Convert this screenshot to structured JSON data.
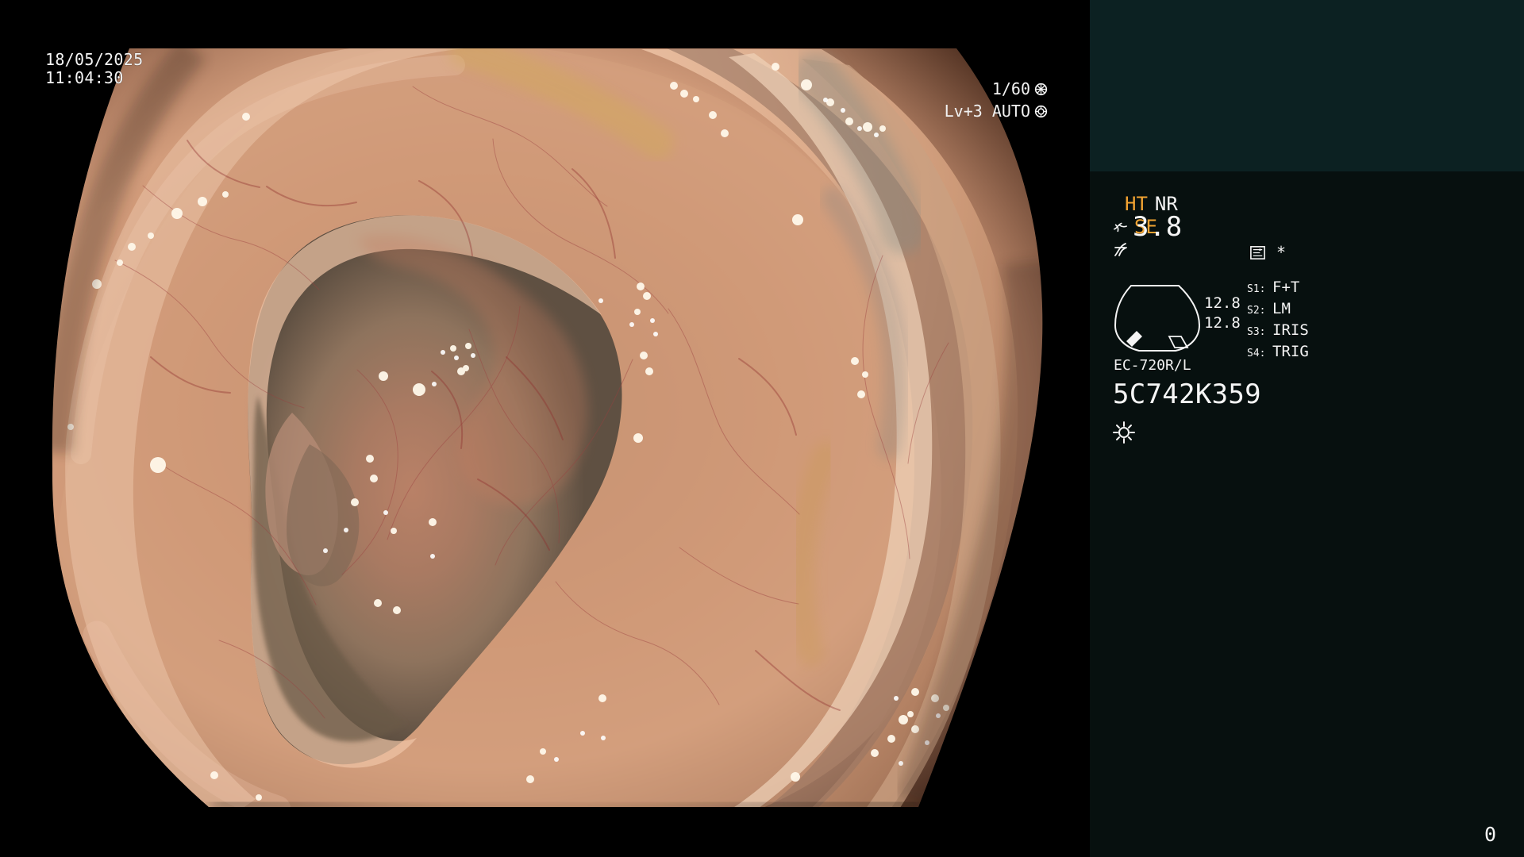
{
  "endoscope_view": {
    "image_alt": "Colonoscopy view of colon lumen with haustral folds",
    "date": "18/05/2025",
    "time": "11:04:30",
    "shutter": "1/60",
    "exposure": "Lv+3 AUTO",
    "camera_icons": {
      "shutter_icon": "shutter-wheel-icon",
      "auto_icon": "auto-target-icon"
    }
  },
  "control_panel": {
    "ht_label": "HT",
    "nr_label": "NR",
    "se_label": "SE",
    "se_icon": "branch-icon",
    "curve_icon": "curve-icon",
    "memo_icon": "memo-icon",
    "asterisk": "*",
    "gauge_value": "3.8",
    "gauge_left_top": "12.8",
    "gauge_left_bottom": "12.8",
    "switches": [
      {
        "key": "S1:",
        "label": "F+T"
      },
      {
        "key": "S2:",
        "label": "LM"
      },
      {
        "key": "S3:",
        "label": "IRIS"
      },
      {
        "key": "S4:",
        "label": "TRIG"
      }
    ],
    "scope_model": "EC-720R/L",
    "scope_serial": "5C742K359",
    "light_icon": "sun-icon"
  },
  "status": {
    "corner_number": "0"
  },
  "colors": {
    "background": "#000000",
    "panel": "#07100F",
    "panel_top": "#0C2122",
    "accent": "#F2A332",
    "text": "#F4F4F4"
  }
}
